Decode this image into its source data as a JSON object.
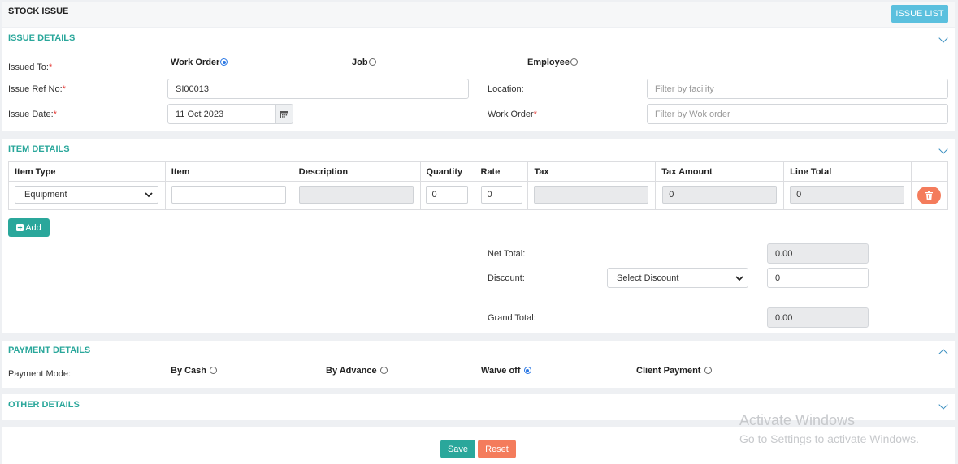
{
  "header": {
    "title": "STOCK ISSUE",
    "issue_list_label": "ISSUE LIST"
  },
  "issue_details": {
    "title": "ISSUE DETAILS",
    "issued_to_label": "Issued To:",
    "issued_to_options": [
      {
        "label": "Work Order",
        "selected": true
      },
      {
        "label": "Job",
        "selected": false
      },
      {
        "label": "Employee",
        "selected": false
      }
    ],
    "issue_ref_label": "Issue Ref No:",
    "issue_ref_value": "SI00013",
    "issue_date_label": "Issue Date:",
    "issue_date_value": "11 Oct 2023",
    "location_label": "Location:",
    "location_placeholder": "Filter by facility",
    "work_order_label": "Work Order",
    "work_order_placeholder": "Filter by Wok order",
    "required_mark": "*"
  },
  "item_details": {
    "title": "ITEM DETAILS",
    "columns": [
      "Item Type",
      "Item",
      "Description",
      "Quantity",
      "Rate",
      "Tax",
      "Tax Amount",
      "Line Total"
    ],
    "row": {
      "item_type": "Equipment",
      "item": "",
      "description": "",
      "quantity": "0",
      "rate": "0",
      "tax": "",
      "tax_amount": "0",
      "line_total": "0"
    },
    "add_label": "Add",
    "net_total_label": "Net Total:",
    "net_total_value": "0.00",
    "discount_label": "Discount:",
    "discount_select": "Select Discount",
    "discount_value": "0",
    "grand_total_label": "Grand Total:",
    "grand_total_value": "0.00"
  },
  "payment_details": {
    "title": "PAYMENT DETAILS",
    "mode_label": "Payment Mode:",
    "options": [
      {
        "label": "By Cash",
        "selected": false
      },
      {
        "label": "By Advance",
        "selected": false
      },
      {
        "label": "Waive off",
        "selected": true
      },
      {
        "label": "Client Payment",
        "selected": false
      }
    ]
  },
  "other_details": {
    "title": "OTHER DETAILS"
  },
  "footer": {
    "save_label": "Save",
    "reset_label": "Reset"
  },
  "watermark": {
    "line1": "Activate Windows",
    "line2": "Go to Settings to activate Windows."
  },
  "colors": {
    "teal": "#2aa79b",
    "info": "#5bc0de",
    "danger": "#f47c5c",
    "link": "#3b8fc0"
  }
}
